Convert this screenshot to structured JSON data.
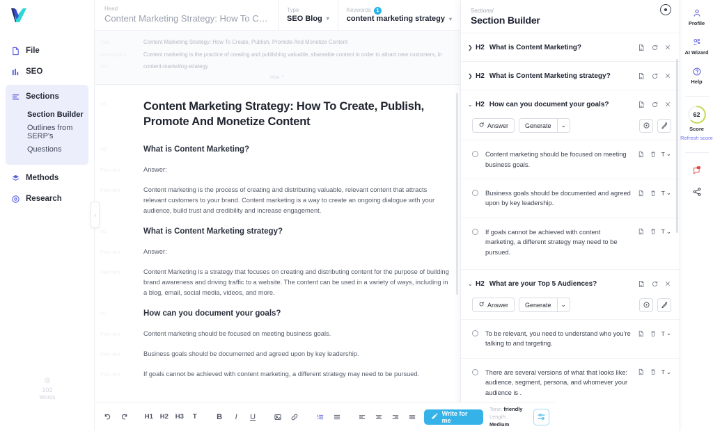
{
  "brand": {
    "logo_name": "brand-logo"
  },
  "topbar": {
    "head_label": "Head",
    "head_value": "Content Marketing Strategy: How To Create, Publ...",
    "type_label": "Type",
    "type_value": "SEO Blog",
    "keywords_label": "Keywords",
    "keywords_count": "1",
    "keywords_value": "content marketing strategy"
  },
  "sidebar": {
    "items": [
      {
        "label": "File",
        "icon": "file-icon"
      },
      {
        "label": "SEO",
        "icon": "chart-icon"
      },
      {
        "label": "Sections",
        "icon": "sections-icon"
      },
      {
        "label": "Methods",
        "icon": "methods-icon"
      },
      {
        "label": "Research",
        "icon": "research-icon"
      }
    ],
    "sub_items": [
      {
        "label": "Section Builder",
        "active": true
      },
      {
        "label": "Outlines from SERP's",
        "active": false
      },
      {
        "label": "Questions",
        "active": false
      }
    ],
    "words_count": "102",
    "words_label": "Words",
    "collapse_label": "Hide"
  },
  "meta": {
    "rows": [
      {
        "label": "Title",
        "value": "Content Marketing Strategy: How To Create, Publish, Promote And Monetize Content"
      },
      {
        "label": "Description",
        "value": "Content marketing is the practice of creating and publishing valuable, shareable content in order to attract new customers, in"
      },
      {
        "label": "Url",
        "value": "content-marketing-strategy"
      }
    ],
    "hide_label": "Hide"
  },
  "editor": {
    "blocks": [
      {
        "gutter": "H1",
        "type": "h1",
        "text": "Content Marketing Strategy: How To Create, Publish, Promote And Monetize Content"
      },
      {
        "gutter": "Plain text",
        "type": "spacer",
        "text": ""
      },
      {
        "gutter": "H2",
        "type": "h2",
        "text": "What is Content Marketing?"
      },
      {
        "gutter": "Plain text",
        "type": "p",
        "text": "Answer:"
      },
      {
        "gutter": "Plain text",
        "type": "p",
        "text": "Content marketing is the process of creating and distributing valuable, relevant content that attracts relevant customers to your brand. Content marketing is a way to create an ongoing dialogue with your audience, build trust and credibility and increase engagement."
      },
      {
        "gutter": "H2",
        "type": "h2",
        "text": "What is Content Marketing strategy?"
      },
      {
        "gutter": "Plain text",
        "type": "p",
        "text": "Answer:"
      },
      {
        "gutter": "Plain text",
        "type": "p",
        "text": "Content Marketing is a strategy that focuses on creating and distributing content for the purpose of building brand awareness and driving traffic to a website. The content can be used in a variety of ways, including in a blog, email, social media, videos, and more."
      },
      {
        "gutter": "H2",
        "type": "h2",
        "text": "How can you document your goals?"
      },
      {
        "gutter": "Plain text",
        "type": "p",
        "text": "Content marketing should be focused on meeting business goals."
      },
      {
        "gutter": "Plain text",
        "type": "p",
        "text": "Business goals should be documented and agreed upon by key leadership."
      },
      {
        "gutter": "Plain text",
        "type": "p",
        "text": "If goals cannot be achieved with content marketing, a different strategy may need to be pursued."
      }
    ]
  },
  "toolbar": {
    "undo": "undo-icon",
    "redo": "redo-icon",
    "headings": [
      "H1",
      "H2",
      "H3",
      "T"
    ],
    "bold": "B",
    "italic": "I",
    "underline": "U",
    "image": "image-icon",
    "link": "link-icon",
    "write_for_me": "Write for me",
    "tone_label": "Tone:",
    "tone_value": "friendly",
    "length_label": "Length:",
    "length_value": "Medium"
  },
  "panel": {
    "breadcrumb": "Sections/",
    "title": "Section Builder",
    "answer_label": "Answer",
    "generate_label": "Generate",
    "tag": "H2",
    "t_label": "T",
    "sections": [
      {
        "heading": "What is Content Marketing?",
        "expanded": false,
        "bullets": []
      },
      {
        "heading": "What is Content Marketing strategy?",
        "expanded": false,
        "bullets": []
      },
      {
        "heading": "How can you document your goals?",
        "expanded": true,
        "bullets": [
          {
            "text": "Content marketing should be focused on meeting business goals."
          },
          {
            "text": "Business goals should be documented and agreed upon by key leadership."
          },
          {
            "text": "If goals cannot be achieved with content marketing, a different strategy may need to be pursued."
          }
        ]
      },
      {
        "heading": "What are your Top 5 Audiences?",
        "expanded": true,
        "bullets": [
          {
            "text": "To be relevant, you need to understand who you’re talking to and targeting."
          },
          {
            "text": "There are several versions of what that looks like: audience, segment, persona, and whomever your audience is ."
          }
        ]
      }
    ]
  },
  "rail": {
    "items": [
      {
        "label": "Profile",
        "icon": "person-icon"
      },
      {
        "label": "AI Wizard",
        "icon": "wizard-icon"
      },
      {
        "label": "Help",
        "icon": "question-circle-icon"
      }
    ],
    "score_value": "62",
    "score_label": "Score",
    "refresh_label": "Refresh score",
    "notification_icon": "notification-icon",
    "share_icon": "share-icon"
  },
  "colors": {
    "accent_purple": "#5b5fe0",
    "accent_blue": "#35b3e8",
    "score_green": "#c3d84a"
  }
}
